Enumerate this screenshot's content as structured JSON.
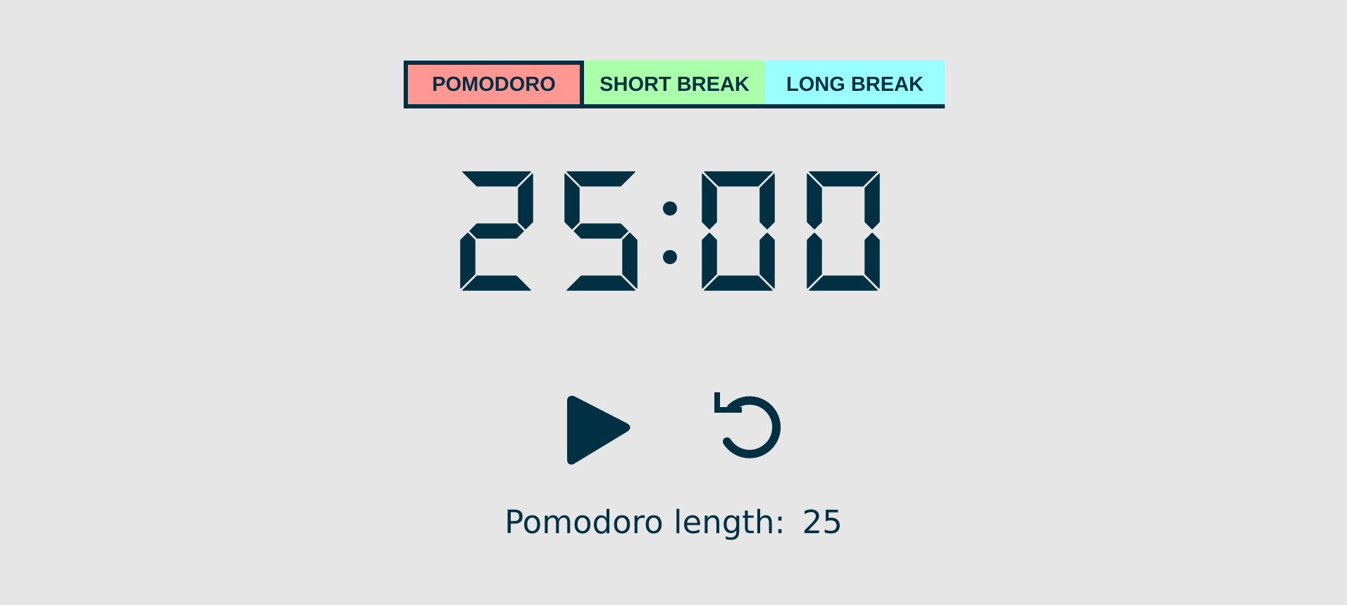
{
  "tabs": [
    {
      "label": "POMODORO",
      "color": "#ff9793",
      "active": true
    },
    {
      "label": "SHORT BREAK",
      "color": "#aaffaa"
    },
    {
      "label": "LONG BREAK",
      "color": "#99ffff"
    }
  ],
  "timer": {
    "minutes": "25",
    "seconds": "00",
    "separator": ":"
  },
  "controls": {
    "play_icon": "play-icon",
    "reset_icon": "reset-icon"
  },
  "length": {
    "label": "Pomodoro length:",
    "value": "25"
  },
  "colors": {
    "background": "#e6e6e6",
    "ink": "#003041"
  }
}
